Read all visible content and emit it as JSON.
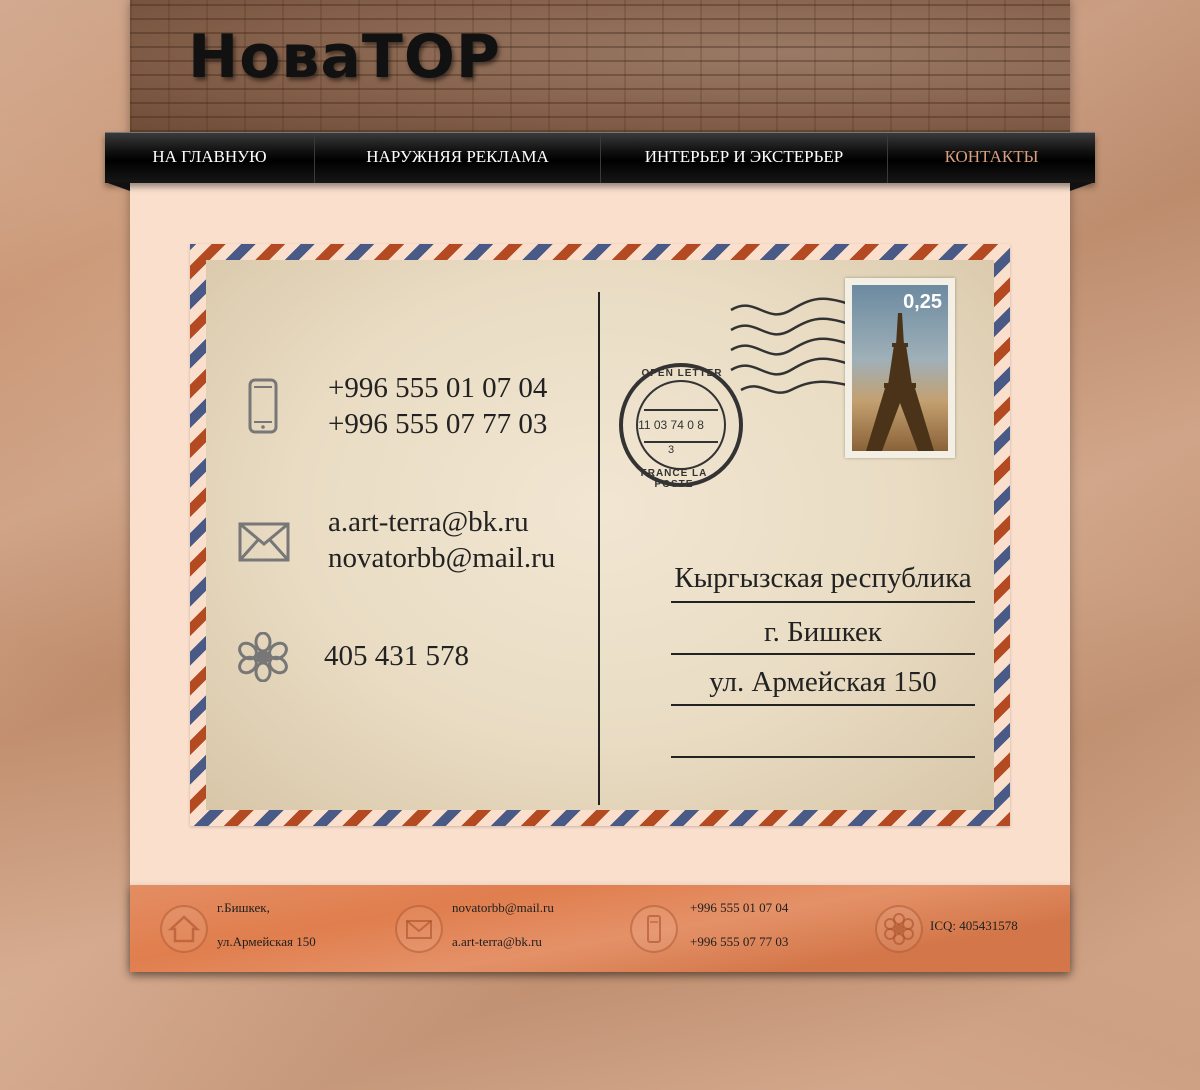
{
  "header": {
    "logo": "НоваТОР"
  },
  "nav": {
    "items": [
      {
        "label": "НА ГЛАВНУЮ"
      },
      {
        "label": "НАРУЖНЯЯ РЕКЛАМА"
      },
      {
        "label": "ИНТЕРЬЕР И ЭКСТЕРЬЕР"
      },
      {
        "label": "КОНТАКТЫ",
        "active": true
      }
    ]
  },
  "postcard": {
    "phones": [
      "+996 555 01 07 04",
      "+996 555 07 77 03"
    ],
    "emails": [
      "a.art-terra@bk.ru",
      "novatorbb@mail.ru"
    ],
    "icq": "405 431 578",
    "postmark": {
      "top": "OPEN LETTER",
      "date": "11 03 74 0 8",
      "number": "3",
      "bottom": "FRANCE LA POSTE"
    },
    "stamp_value": "0,25",
    "address": [
      "Кыргызская республика",
      "г. Бишкек",
      "ул. Армейская 150"
    ]
  },
  "footer": {
    "address_line1": "г.Бишкек,",
    "address_line2": "ул.Армейская 150",
    "email1": "novatorbb@mail.ru",
    "email2": "a.art-terra@bk.ru",
    "phone1": "+996 555 01 07 04",
    "phone2": "+996 555 07 77 03",
    "icq": "ICQ: 405431578"
  },
  "colors": {
    "accent": "#d9a080",
    "footer": "#e07e4e",
    "page": "#fadfcd"
  }
}
